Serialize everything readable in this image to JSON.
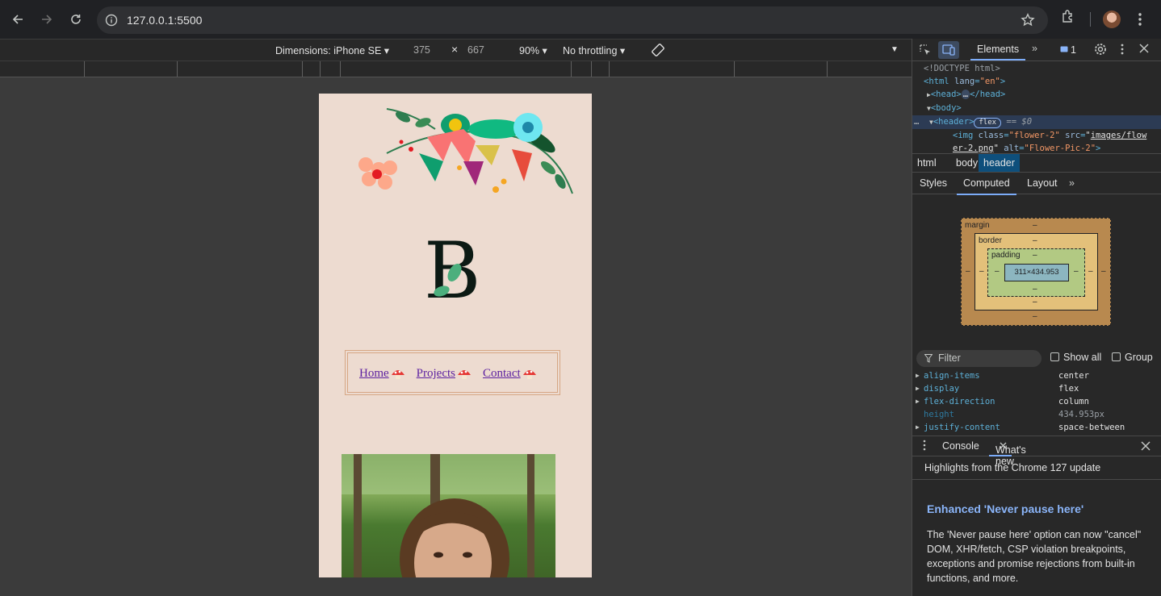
{
  "browser": {
    "url": "127.0.0.1:5500"
  },
  "device_toolbar": {
    "dimensions_label": "Dimensions: iPhone SE",
    "width": "375",
    "times": "×",
    "height": "667",
    "zoom": "90%",
    "throttling": "No throttling"
  },
  "site": {
    "monogram": "B",
    "nav": [
      {
        "label": "Home"
      },
      {
        "label": "Projects"
      },
      {
        "label": "Contact"
      }
    ]
  },
  "devtools": {
    "tabs": {
      "elements": "Elements",
      "issues_count": "1"
    },
    "dom": {
      "doctype": "<!DOCTYPE html>",
      "html_open": "<html",
      "lang_attr": "lang",
      "lang_val": "\"en\"",
      "head": "<head>",
      "head_close": "</head>",
      "body": "<body>",
      "header": "<header>",
      "flex_badge": "flex",
      "eq_sign": "== $0",
      "img_tag": "<img",
      "img_class_attr": "class",
      "img_class_val": "\"flower-2\"",
      "img_src_attr": "src",
      "img_src_val1": "images/flow",
      "img_src_val2": "er-2.png",
      "img_alt_attr": "alt",
      "img_alt_val": "\"Flower-Pic-2\"",
      "close": ">"
    },
    "breadcrumbs": [
      "html",
      "body",
      "header"
    ],
    "subtabs": {
      "styles": "Styles",
      "computed": "Computed",
      "layout": "Layout"
    },
    "box_model": {
      "margin": "margin",
      "border": "border",
      "padding": "padding",
      "content": "311×434.953",
      "dash": "–"
    },
    "filter": {
      "placeholder": "Filter",
      "show_all": "Show all",
      "group": "Group"
    },
    "computed": [
      {
        "name": "align-items",
        "value": "center"
      },
      {
        "name": "display",
        "value": "flex"
      },
      {
        "name": "flex-direction",
        "value": "column"
      },
      {
        "name": "height",
        "value": "434.953px"
      },
      {
        "name": "justify-content",
        "value": "space-between"
      }
    ],
    "drawer": {
      "console": "Console",
      "whats_new": "What's new",
      "highlights": "Highlights from the Chrome 127 update",
      "headline": "Enhanced 'Never pause here'",
      "body": "The 'Never pause here' option can now \"cancel\" DOM, XHR/fetch, CSP violation breakpoints, exceptions and promise rejections from built-in functions, and more."
    }
  }
}
